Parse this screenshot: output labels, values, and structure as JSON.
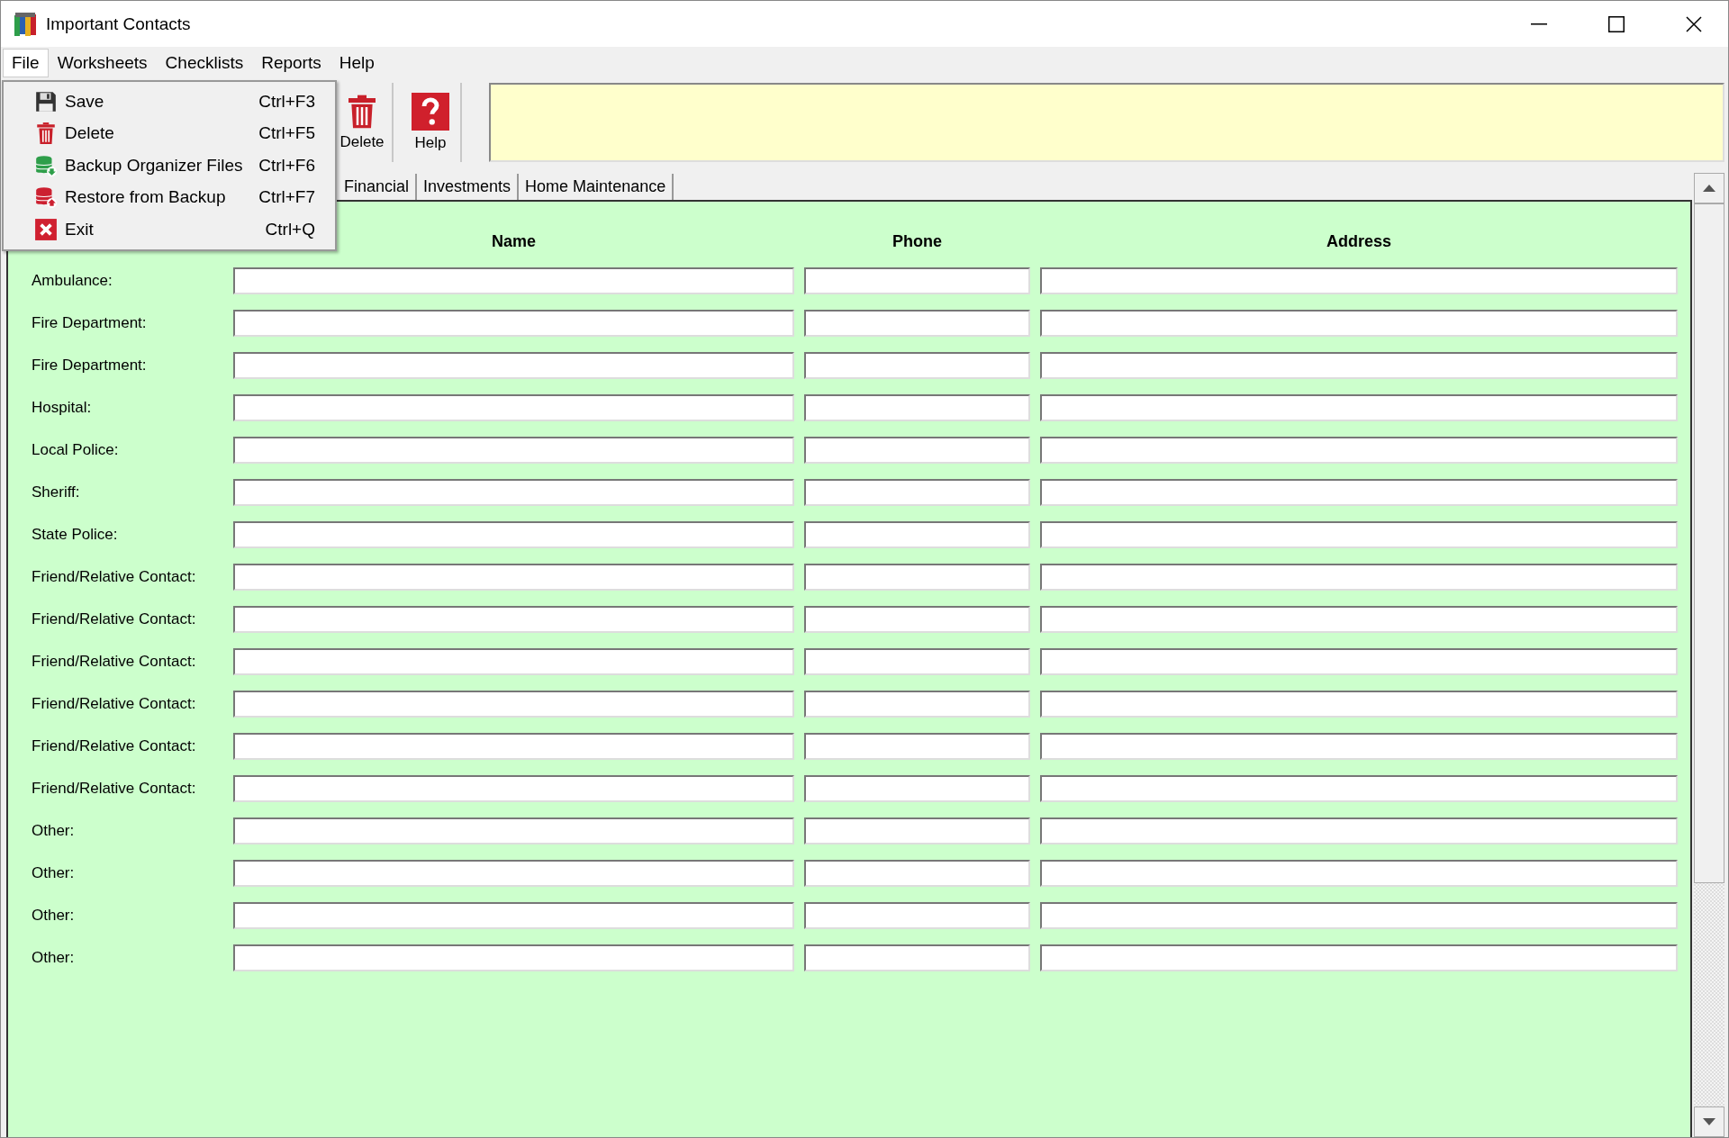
{
  "window": {
    "title": "Important Contacts"
  },
  "menu_bar": [
    {
      "label": "File",
      "selected": true
    },
    {
      "label": "Worksheets",
      "selected": false
    },
    {
      "label": "Checklists",
      "selected": false
    },
    {
      "label": "Reports",
      "selected": false
    },
    {
      "label": "Help",
      "selected": false
    }
  ],
  "file_menu": [
    {
      "label": "Save",
      "shortcut": "Ctrl+F3",
      "kind": "save"
    },
    {
      "label": "Delete",
      "shortcut": "Ctrl+F5",
      "kind": "delete"
    },
    {
      "label": "Backup Organizer Files",
      "shortcut": "Ctrl+F6",
      "kind": "backup"
    },
    {
      "label": "Restore from Backup",
      "shortcut": "Ctrl+F7",
      "kind": "restore"
    },
    {
      "label": "Exit",
      "shortcut": "Ctrl+Q",
      "kind": "exit"
    }
  ],
  "toolbar": [
    {
      "label": "Delete",
      "kind": "delete"
    },
    {
      "label": "Help",
      "kind": "help"
    }
  ],
  "tabs": [
    {
      "label": "Financial",
      "selected": false
    },
    {
      "label": "Investments",
      "selected": false
    },
    {
      "label": "Home Maintenance",
      "selected": false
    }
  ],
  "columns": [
    "Name",
    "Phone",
    "Address"
  ],
  "rows": [
    {
      "label": "Ambulance:"
    },
    {
      "label": "Fire Department:"
    },
    {
      "label": "Fire Department:"
    },
    {
      "label": "Hospital:"
    },
    {
      "label": "Local Police:"
    },
    {
      "label": "Sheriff:"
    },
    {
      "label": "State Police:"
    },
    {
      "label": "Friend/Relative Contact:"
    },
    {
      "label": "Friend/Relative Contact:"
    },
    {
      "label": "Friend/Relative Contact:"
    },
    {
      "label": "Friend/Relative Contact:"
    },
    {
      "label": "Friend/Relative Contact:"
    },
    {
      "label": "Friend/Relative Contact:"
    },
    {
      "label": "Other:"
    },
    {
      "label": "Other:"
    },
    {
      "label": "Other:"
    },
    {
      "label": "Other:"
    }
  ]
}
